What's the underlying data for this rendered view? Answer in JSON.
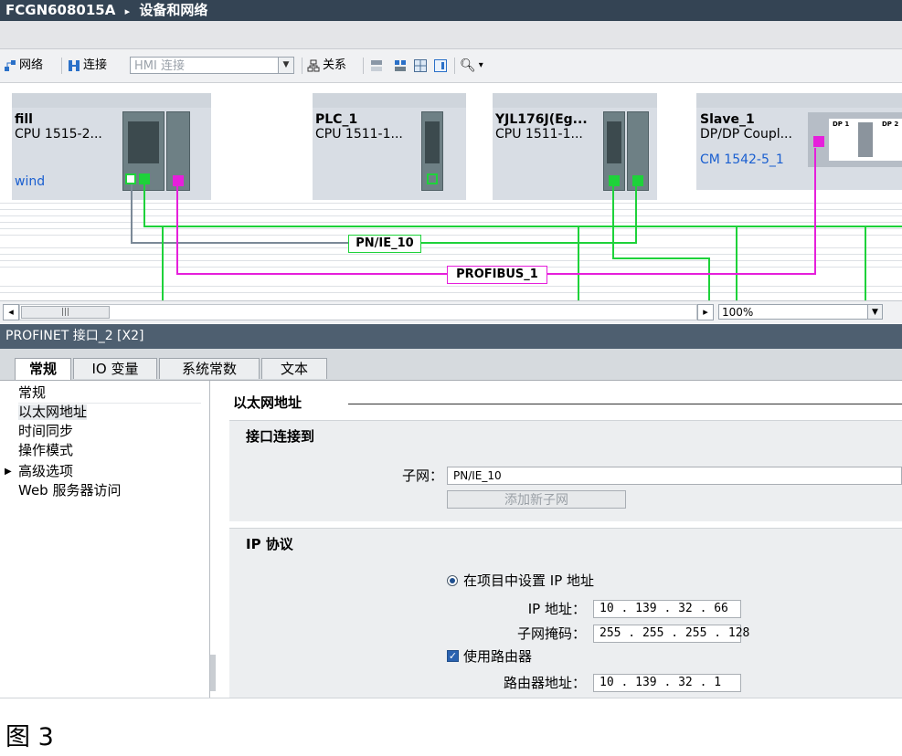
{
  "title": {
    "project": "FCGN608015A",
    "separator": "▸",
    "page": "设备和网络"
  },
  "toolbar": {
    "network_label": "网络",
    "connection_label": "连接",
    "hmi_placeholder": "HMI 连接",
    "relation_label": "关系",
    "zoom_icon": "zoom-icon"
  },
  "devices": [
    {
      "name": "fill",
      "type": "CPU 1515-2...",
      "link": "wind"
    },
    {
      "name": "PLC_1",
      "type": "CPU 1511-1...",
      "link": ""
    },
    {
      "name": "YJL176J(Eg...",
      "type": "CPU 1511-1...",
      "link": ""
    },
    {
      "name": "Slave_1",
      "type": "DP/DP Coupl...",
      "link": "CM 1542-5_1"
    }
  ],
  "coupler_labels": {
    "left": "DP 1",
    "right": "DP 2"
  },
  "networks": {
    "profinet": "PN/IE_10",
    "profibus": "PROFIBUS_1"
  },
  "colors": {
    "profinet": "#1ed23a",
    "profibus": "#e61fdb",
    "title_bar": "#344454"
  },
  "zoom": "100%",
  "panel": {
    "title": "PROFINET 接口_2 [X2]"
  },
  "tabs": [
    "常规",
    "IO 变量",
    "系统常数",
    "文本"
  ],
  "nav": [
    "常规",
    "以太网地址",
    "时间同步",
    "操作模式",
    "高级选项",
    "Web 服务器访问"
  ],
  "section_heading": "以太网地址",
  "interface": {
    "title": "接口连接到",
    "subnet_label": "子网：",
    "subnet_value": "PN/IE_10",
    "add_subnet_button": "添加新子网"
  },
  "ip": {
    "title": "IP 协议",
    "set_in_project": "在项目中设置 IP 地址",
    "ip_label": "IP 地址：",
    "ip_value": "10  . 139 . 32  . 66",
    "mask_label": "子网掩码：",
    "mask_value": "255 . 255 . 255 . 128",
    "use_router": "使用路由器",
    "router_label": "路由器地址：",
    "router_value": "10  . 139 . 32  . 1"
  },
  "figure_caption": "图 3"
}
